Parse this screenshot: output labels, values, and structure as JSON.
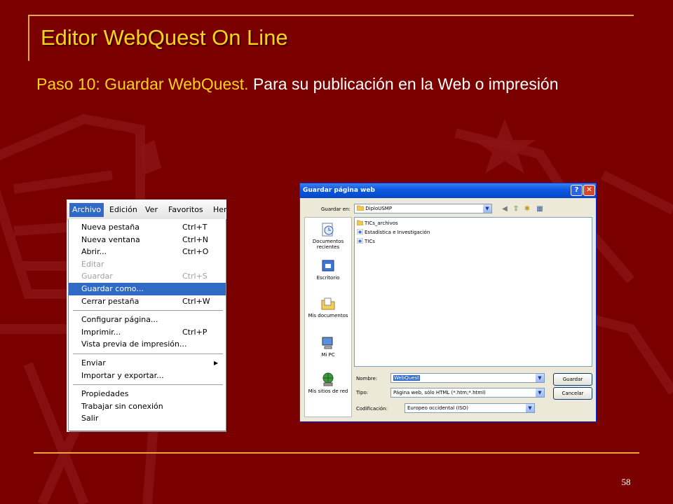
{
  "slide": {
    "title": "Editor WebQuest On Line",
    "step_lead": "Paso 10: Guardar WebQuest.",
    "step_rest": " Para su publicación en la Web o impresión",
    "page_number": "58"
  },
  "ie_menu": {
    "menubar": [
      "Archivo",
      "Edición",
      "Ver",
      "Favoritos",
      "Her"
    ],
    "groups": [
      [
        {
          "label": "Nueva pestaña",
          "shortcut": "Ctrl+T"
        },
        {
          "label": "Nueva ventana",
          "shortcut": "Ctrl+N"
        },
        {
          "label": "Abrir...",
          "shortcut": "Ctrl+O"
        },
        {
          "label": "Editar",
          "shortcut": ""
        },
        {
          "label": "Guardar",
          "shortcut": "Ctrl+S"
        },
        {
          "label": "Guardar como...",
          "shortcut": ""
        },
        {
          "label": "Cerrar pestaña",
          "shortcut": "Ctrl+W"
        }
      ],
      [
        {
          "label": "Configurar página...",
          "shortcut": ""
        },
        {
          "label": "Imprimir...",
          "shortcut": "Ctrl+P"
        },
        {
          "label": "Vista previa de impresión...",
          "shortcut": ""
        }
      ],
      [
        {
          "label": "Enviar",
          "shortcut": ""
        },
        {
          "label": "Importar y exportar...",
          "shortcut": ""
        }
      ],
      [
        {
          "label": "Propiedades",
          "shortcut": ""
        },
        {
          "label": "Trabajar sin conexión",
          "shortcut": ""
        },
        {
          "label": "Salir",
          "shortcut": ""
        }
      ]
    ]
  },
  "save_dialog": {
    "title": "Guardar página web",
    "save_in_label": "Guardar en:",
    "save_in_value": "DiploUSMP",
    "places": [
      "Documentos recientes",
      "Escritorio",
      "Mis documentos",
      "Mi PC",
      "Mis sitios de red"
    ],
    "files": [
      "TICs_archivos",
      "Estadística e Investigación",
      "TICs"
    ],
    "name_label": "Nombre:",
    "name_value": "WebQuest",
    "type_label": "Tipo:",
    "type_value": "Página web, sólo HTML (*.htm;*.html)",
    "encoding_label": "Codificación:",
    "encoding_value": "Europeo occidental (ISO)",
    "save_button": "Guardar",
    "cancel_button": "Cancelar"
  },
  "colors": {
    "background": "#7a0000",
    "title": "#ffd21a",
    "rule": "#e6a64a",
    "menu_highlight": "#316ac5"
  }
}
